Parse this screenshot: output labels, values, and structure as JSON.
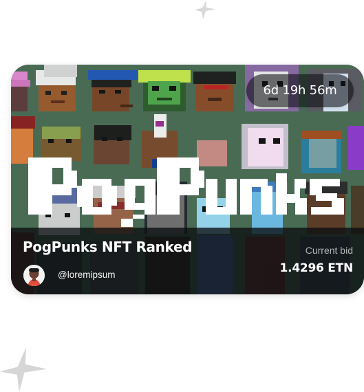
{
  "auction": {
    "time_remaining": "6d 19h 56m"
  },
  "nft": {
    "title": "PogPunks NFT Ranked",
    "collection_logo": "PogPunks",
    "owner_handle": "@loremipsum",
    "avatar_icon": "user-avatar"
  },
  "bid": {
    "label": "Current bid",
    "value": "1.4296 ETN"
  },
  "decorations": {
    "sparkle_icon": "four-point-star-icon",
    "background_color": "#ffffff",
    "card_art_background": "#496b54"
  }
}
